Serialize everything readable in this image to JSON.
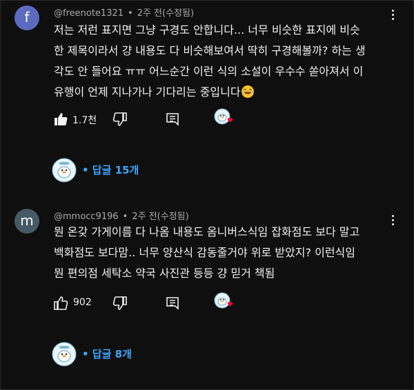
{
  "colors": {
    "background": "#0f0f0f",
    "text_primary": "#f1f1f1",
    "text_secondary": "#aaaaaa",
    "reply_link": "#3ea6ff",
    "heart": "#ff0033",
    "avatar_f": "#5c6bc0",
    "avatar_m": "#455a64"
  },
  "comments": [
    {
      "avatar_letter": "f",
      "username": "@freenote1321",
      "time": "2주 전(수정됨)",
      "text": "저는 저런 표지면 그냥 구경도 안합니다... 너무 비슷한 표지에 비슷\n한 제목이라서 걍 내용도 다 비슷해보여서 딱히 구경해볼까? 하는 생\n각도 안 들어요 ㅠㅠ 어느순간 이런 식의 소설이 우수수 쏟아져서 이\n유행이 언제 지나가나 기다리는 중입니다",
      "emoji": "laughing-with-tears-emoji",
      "likes": "1.7천",
      "liked": true,
      "replies_label": "• 답글 15개"
    },
    {
      "avatar_letter": "m",
      "username": "@mmocc9196",
      "time": "2주 전(수정됨)",
      "text": "뭔 온갖 가게이름 다 나옴 내용도 옴니버스식임 잡화점도 보다 말고\n백화점도 보다맘.. 너무 양산식 감동줄거야 위로 받았지? 이런식임\n뭔 편의점 세탁소 약국 사진관 등등 걍 믿거 책됨",
      "likes": "902",
      "liked": false,
      "replies_label": "• 답글 8개"
    }
  ],
  "separator": "•"
}
